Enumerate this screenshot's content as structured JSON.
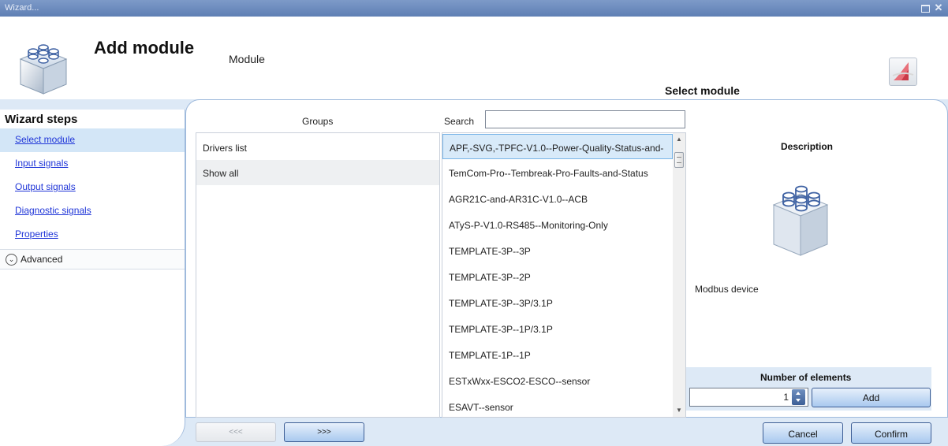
{
  "window": {
    "title": "Wizard..."
  },
  "header": {
    "title": "Add module",
    "subtitle": "Module",
    "step_title": "Select module"
  },
  "sidebar": {
    "title": "Wizard steps",
    "items": [
      {
        "label": "Select module",
        "active": true
      },
      {
        "label": "Input signals",
        "active": false
      },
      {
        "label": "Output signals",
        "active": false
      },
      {
        "label": "Diagnostic signals",
        "active": false
      },
      {
        "label": "Properties",
        "active": false
      }
    ],
    "advanced_label": "Advanced"
  },
  "groups": {
    "header": "Groups",
    "items": [
      {
        "label": "Drivers list"
      },
      {
        "label": "Show all"
      }
    ]
  },
  "search": {
    "label": "Search",
    "value": "",
    "placeholder": ""
  },
  "drivers": {
    "items": [
      "APF,-SVG,-TPFC-V1.0--Power-Quality-Status-and-",
      "TemCom-Pro--Tembreak-Pro-Faults-and-Status",
      "AGR21C-and-AR31C-V1.0--ACB",
      "ATyS-P-V1.0-RS485--Monitoring-Only",
      "TEMPLATE-3P--3P",
      "TEMPLATE-3P--2P",
      "TEMPLATE-3P--3P/3.1P",
      "TEMPLATE-3P--1P/3.1P",
      "TEMPLATE-1P--1P",
      "ESTxWxx-ESCO2-ESCO--sensor",
      "ESAVT--sensor"
    ]
  },
  "description": {
    "title": "Description",
    "text": "Modbus device"
  },
  "number_of_elements": {
    "title": "Number of elements",
    "value": "1",
    "add_label": "Add"
  },
  "footer": {
    "prev_label": "<<<",
    "next_label": ">>>",
    "cancel_label": "Cancel",
    "confirm_label": "Confirm"
  },
  "colors": {
    "accent": "#dde9f6",
    "link": "#1f35d8",
    "selection": "#d8eaf9",
    "titlebar": "#6b8abd"
  }
}
